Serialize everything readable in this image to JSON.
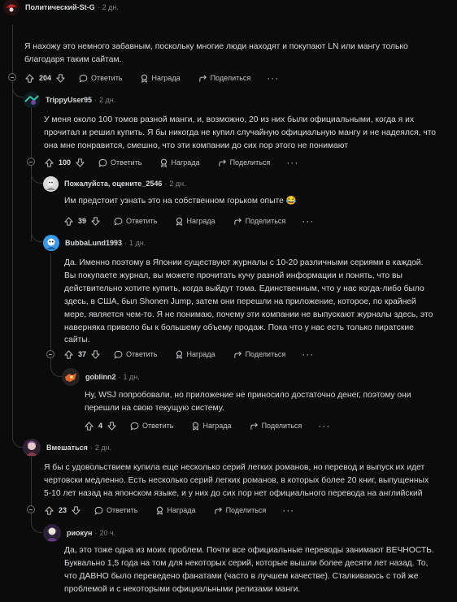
{
  "comments": [
    {
      "author": "Политический-St-G",
      "time": "2 дн.",
      "lines": [
        "Я нахожу это немного забавным, поскольку многие люди находят и покупают LN или мангу только",
        "благодаря таким сайтам."
      ],
      "votes": "204"
    },
    {
      "author": "TrippyUser95",
      "time": "2 дн.",
      "lines": [
        "У меня около 100 томов разной манги, и, возможно, 20 из них были официальными, когда я их",
        "прочитал и решил купить. Я бы никогда не купил случайную официальную мангу и не надеялся, что",
        "она мне понравится, смешно, что эти компании до сих пор этого не понимают"
      ],
      "votes": "100"
    },
    {
      "author": "Пожалуйста, оцените_2546",
      "time": "2 дн.",
      "lines": [
        "Им предстоит узнать это на собственном горьком опыте 😂"
      ],
      "votes": "39"
    },
    {
      "author": "BubbaLund1993",
      "time": "1 дн.",
      "lines": [
        "Да. Именно поэтому в Японии существуют журналы с 10-20 различными сериями в каждой.",
        "Вы покупаете журнал, вы можете прочитать кучу разной информации и понять, что вы",
        "действительно хотите купить, когда выйдут тома. Единственным, что у нас когда-либо было",
        "здесь, в США, был Shonen Jump, затем они перешли на приложение, которое, по крайней",
        "мере, является чем-то. Я не понимаю, почему эти компании не выпускают журналы здесь, это",
        "наверняка привело бы к большему объему продаж. Пока что у нас есть только пиратские",
        "сайты."
      ],
      "votes": "37"
    },
    {
      "author": "goblinn2",
      "time": "1 дн.",
      "lines": [
        "Ну, WSJ попробовали, но приложение не приносило достаточно денег, поэтому они",
        "перешли на свою текущую систему."
      ],
      "votes": "4"
    },
    {
      "author": "Вмешаться",
      "time": "2 дн.",
      "lines": [
        "Я бы с удовольствием купила еще несколько серий легких романов, но перевод и выпуск их идет",
        "чертовски медленно. Есть несколько серий легких романов, в которых более 20 книг, выпущенных",
        "5-10 лет назад на японском языке, и у них до сих пор нет официального перевода на английский"
      ],
      "votes": "23"
    },
    {
      "author": "риокун",
      "time": "20 ч.",
      "lines": [
        "Да, это тоже одна из моих проблем. Почти все официальные переводы занимают ВЕЧНОСТЬ.",
        "Буквально 1,5 года на том для некоторых серий, которые вышли более десяти лет назад. То,",
        "что ДАВНО было переведено фанатами (часто в лучшем качестве). Сталкиваюсь с той же",
        "проблемой и с некоторыми официальными релизами манги."
      ]
    }
  ],
  "labels": {
    "reply": "Ответить",
    "award": "Награда",
    "share": "Поделиться",
    "more": "···",
    "separator": "·"
  },
  "icons": {
    "upvote": "upvote-arrow-icon",
    "downvote": "downvote-arrow-icon",
    "reply": "speech-bubble-icon",
    "award": "award-ribbon-icon",
    "share": "share-arrow-icon",
    "collapse": "collapse-minus-icon"
  },
  "colors": {
    "background": "#0b0b0c",
    "text": "#d7dadc",
    "meta": "#818384",
    "thread_line": "#343536"
  }
}
